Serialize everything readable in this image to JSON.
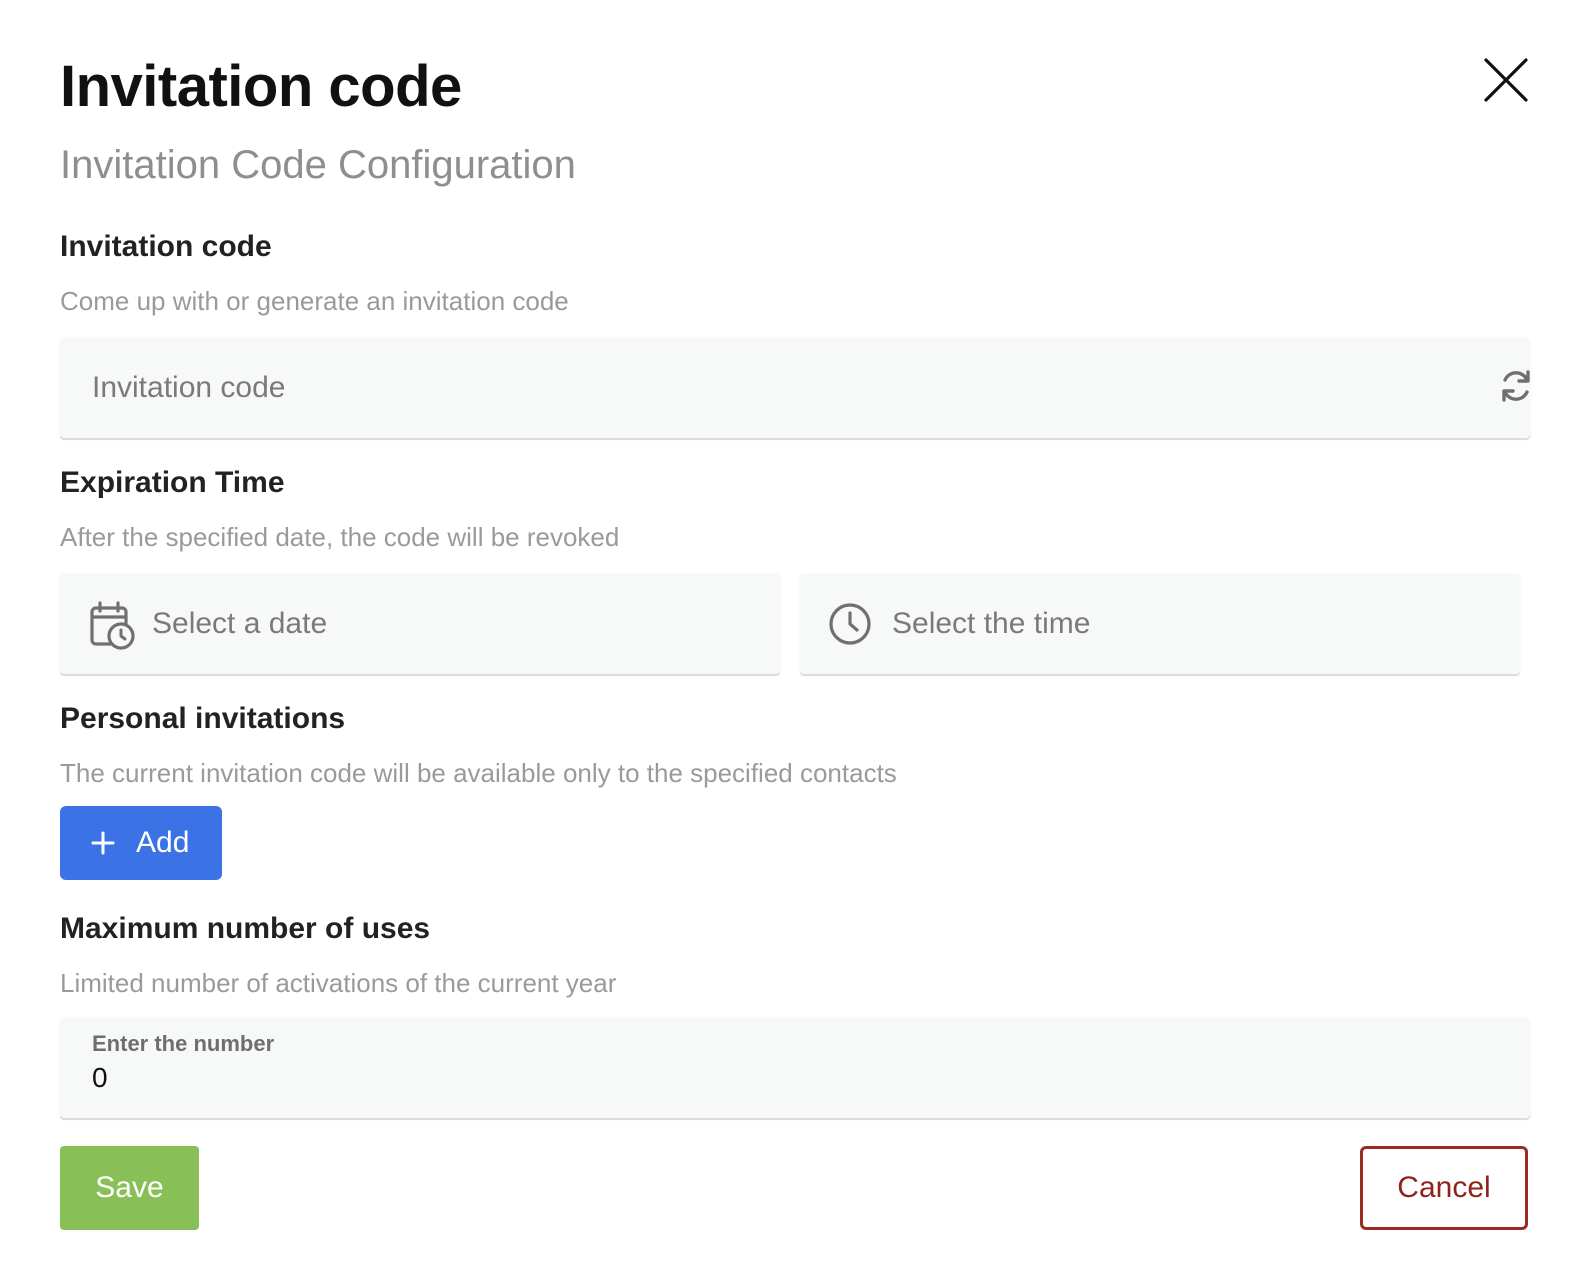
{
  "dialog": {
    "title": "Invitation code",
    "subtitle": "Invitation Code Configuration",
    "close_icon": "close-icon"
  },
  "invitation_code": {
    "title": "Invitation code",
    "description": "Come up with or generate an invitation code",
    "placeholder": "Invitation code",
    "icon": "refresh-icon"
  },
  "expiration": {
    "title": "Expiration Time",
    "description": "After the specified date, the code will be revoked",
    "date_placeholder": "Select a date",
    "date_icon": "calendar-clock-icon",
    "time_placeholder": "Select the time",
    "time_icon": "clock-icon"
  },
  "personal_invitations": {
    "title": "Personal invitations",
    "description": "The current invitation code will be available only to the specified contacts",
    "add_label": "Add",
    "add_icon": "plus-icon"
  },
  "max_uses": {
    "title": "Maximum number of uses",
    "description": "Limited number of activations of the current year",
    "label": "Enter the number",
    "value": "0"
  },
  "actions": {
    "save_label": "Save",
    "cancel_label": "Cancel"
  },
  "colors": {
    "primary": "#3b73e6",
    "success": "#88c057",
    "danger": "#9a2a22"
  }
}
